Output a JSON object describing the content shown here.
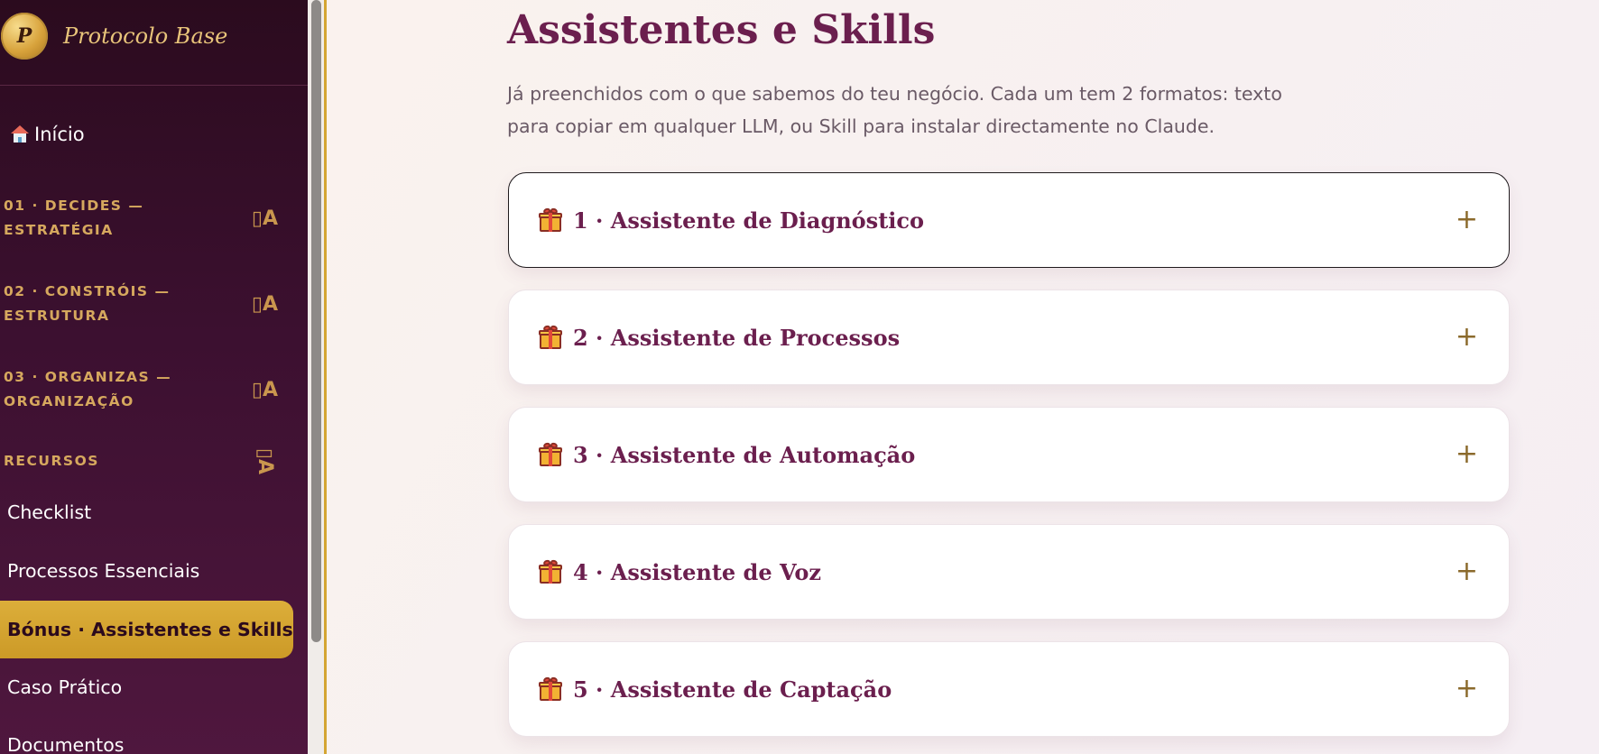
{
  "brand": {
    "logo_letter": "P",
    "name": "Protocolo Base"
  },
  "nav": {
    "home": "Início",
    "sections": [
      {
        "label": "01 · DECIDES —\nESTRATÉGIA",
        "toggle": "▯A"
      },
      {
        "label": "02 · CONSTRÓIS —\nESTRUTURA",
        "toggle": "▯A"
      },
      {
        "label": "03 · ORGANIZAS —\nORGANIZAÇÃO",
        "toggle": "▯A"
      },
      {
        "label": "RECURSOS",
        "toggle": "▯A"
      }
    ],
    "items": [
      {
        "label": "Checklist",
        "active": false
      },
      {
        "label": "Processos Essenciais",
        "active": false
      },
      {
        "label": "Bónus · Assistentes e Skills",
        "active": true
      },
      {
        "label": "Caso Prático",
        "active": false
      },
      {
        "label": "Documentos",
        "active": false
      }
    ]
  },
  "main": {
    "title": "Assistentes e Skills",
    "intro": "Já preenchidos com o que sabemos do teu negócio. Cada um tem 2 formatos: texto para copiar em qualquer LLM, ou Skill para instalar directamente no Claude.",
    "assistants": [
      {
        "title": "1 · Assistente de Diagnóstico",
        "toggle": "+"
      },
      {
        "title": "2 · Assistente de Processos",
        "toggle": "+"
      },
      {
        "title": "3 · Assistente de Automação",
        "toggle": "+"
      },
      {
        "title": "4 · Assistente de Voz",
        "toggle": "+"
      },
      {
        "title": "5 · Assistente de Captação",
        "toggle": "+"
      }
    ]
  },
  "colors": {
    "sidebar_bg": "#3c1030",
    "accent_gold": "#d4a533",
    "title_plum": "#6b1f4e"
  }
}
